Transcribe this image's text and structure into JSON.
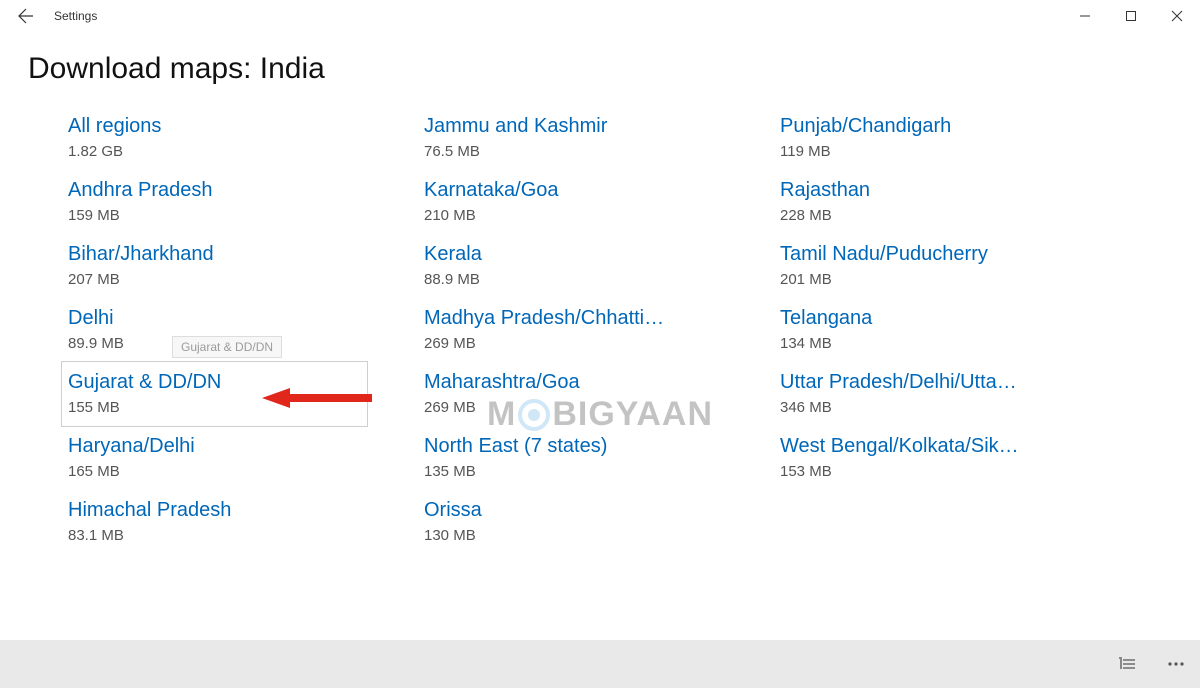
{
  "app": {
    "title": "Settings"
  },
  "page": {
    "heading": "Download maps: India"
  },
  "highlight": {
    "tooltip": "Gujarat & DD/DN",
    "index_col": 0,
    "index_row": 4
  },
  "watermark": {
    "left": "M",
    "right": "BIGYAAN"
  },
  "columns": [
    [
      {
        "name": "All regions",
        "size": "1.82 GB"
      },
      {
        "name": "Andhra Pradesh",
        "size": "159 MB"
      },
      {
        "name": "Bihar/Jharkhand",
        "size": "207 MB"
      },
      {
        "name": "Delhi",
        "size": "89.9 MB"
      },
      {
        "name": "Gujarat & DD/DN",
        "size": "155 MB"
      },
      {
        "name": "Haryana/Delhi",
        "size": "165 MB"
      },
      {
        "name": "Himachal Pradesh",
        "size": "83.1 MB"
      }
    ],
    [
      {
        "name": "Jammu and Kashmir",
        "size": "76.5 MB"
      },
      {
        "name": "Karnataka/Goa",
        "size": "210 MB"
      },
      {
        "name": "Kerala",
        "size": "88.9 MB"
      },
      {
        "name": "Madhya Pradesh/Chhatti…",
        "size": "269 MB"
      },
      {
        "name": "Maharashtra/Goa",
        "size": "269 MB"
      },
      {
        "name": "North East (7 states)",
        "size": "135 MB"
      },
      {
        "name": "Orissa",
        "size": "130 MB"
      }
    ],
    [
      {
        "name": "Punjab/Chandigarh",
        "size": "119 MB"
      },
      {
        "name": "Rajasthan",
        "size": "228 MB"
      },
      {
        "name": "Tamil Nadu/Puducherry",
        "size": "201 MB"
      },
      {
        "name": "Telangana",
        "size": "134 MB"
      },
      {
        "name": "Uttar Pradesh/Delhi/Utta…",
        "size": "346 MB"
      },
      {
        "name": "West Bengal/Kolkata/Sik…",
        "size": "153 MB"
      }
    ]
  ]
}
